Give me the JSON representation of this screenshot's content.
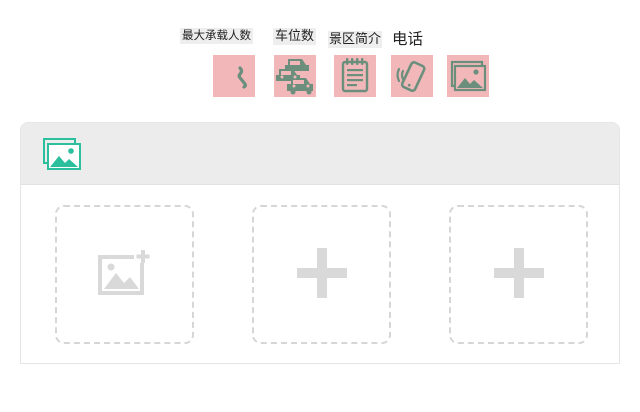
{
  "labels": {
    "max_capacity": "最大承载人数",
    "parking_spaces": "车位数",
    "scenic_intro": "景区简介",
    "phone": "电话"
  },
  "icons": {
    "tile_1": "phone-curve-icon",
    "tile_2": "cars-icon",
    "tile_3": "notepad-icon",
    "tile_4": "vibrating-phone-icon",
    "tile_5": "gallery-icon",
    "card_header": "gallery-icon",
    "slot_1": "add-image-icon",
    "slot_2": "plus-icon",
    "slot_3": "plus-icon"
  },
  "colors": {
    "tile_bg": "#f2b8b9",
    "tile_glyph": "#6b8f7c",
    "accent_teal": "#2bbf9e",
    "placeholder_glyph": "#d9d9d9"
  }
}
